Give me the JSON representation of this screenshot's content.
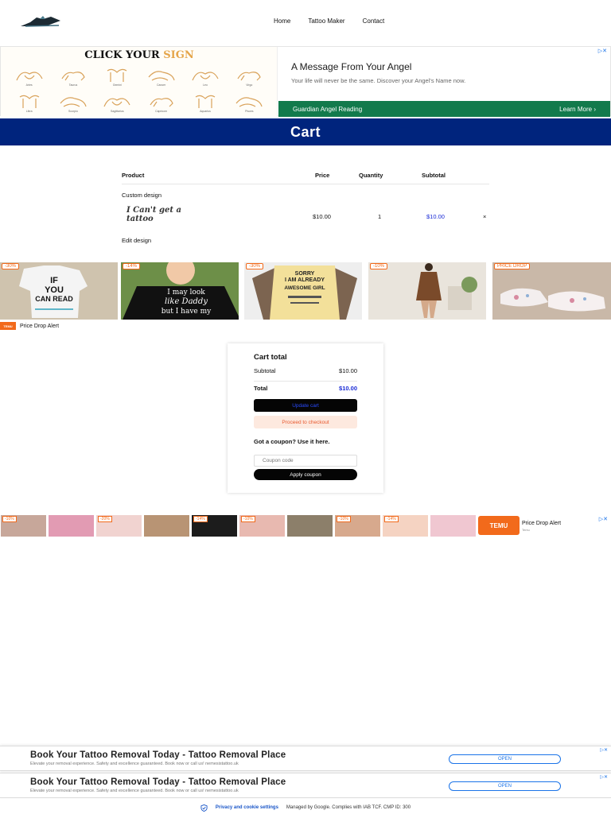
{
  "header": {
    "nav": [
      "Home",
      "Tattoo Maker",
      "Contact"
    ]
  },
  "ad_top": {
    "zodiac_title_a": "CLICK YOUR ",
    "zodiac_title_b": "SIGN",
    "signs": [
      "Aries",
      "Taurus",
      "Gemini",
      "Cancer",
      "Leo",
      "Virgo",
      "Libra",
      "Scorpio",
      "Sagittarius",
      "Capricorn",
      "Aquarius",
      "Pisces"
    ],
    "headline": "A Message From Your Angel",
    "subtext": "Your life will never be the same. Discover your Angel's Name now.",
    "brand": "Guardian Angel Reading",
    "cta": "Learn More",
    "cta_icon": "chevron-right-icon"
  },
  "page_title": "Cart",
  "cart": {
    "columns": [
      "Product",
      "Price",
      "Quantity",
      "Subtotal"
    ],
    "group_label": "Custom design",
    "item": {
      "thumb_text": "I Can't get a tattoo",
      "price": "$10.00",
      "quantity": "1",
      "subtotal": "$10.00",
      "remove": "×"
    },
    "edit_label": "Edit design"
  },
  "ad_products": {
    "badges": [
      "-30%",
      "-14%",
      "-30%",
      "-10%",
      "PRICE DROP"
    ],
    "tee_text_1": "IF YOU CAN READ",
    "tee_text_2": "I may look like my Daddy but I have my Mommy's",
    "tee_text_3": "SORRY I AM ALREADY AWESOME GIRL",
    "brand_small": "TEMU",
    "label": "Price Drop Alert",
    "sublabel": "Temu"
  },
  "cart_total": {
    "title": "Cart total",
    "subtotal_label": "Subtotal",
    "subtotal_value": "$10.00",
    "total_label": "Total",
    "total_value": "$10.00",
    "update_button": "Update cart",
    "checkout_button": "Proceed to checkout",
    "coupon_title": "Got a coupon? Use it here.",
    "coupon_placeholder": "Coupon code",
    "apply_button": "Apply coupon"
  },
  "ad_strip": {
    "badges": [
      "-10%",
      "",
      "-20%",
      "",
      "-14%",
      "-10%",
      "",
      "-10%",
      "-14%",
      ""
    ],
    "brand": "TEMU",
    "label": "Price Drop Alert",
    "sublabel": "Temu"
  },
  "bottom_ads": [
    {
      "headline": "Book Your Tattoo Removal Today - Tattoo Removal Place",
      "subtext": "Elevate your removal experience. Safety and excellence guaranteed. Book now or call us! nemesistattoo.uk",
      "cta": "OPEN"
    },
    {
      "headline": "Book Your Tattoo Removal Today - Tattoo Removal Place",
      "subtext": "Elevate your removal experience. Safety and excellence guaranteed. Book now or call us! nemesistattoo.uk",
      "cta": "OPEN"
    }
  ],
  "footer": {
    "privacy": "Privacy and cookie settings",
    "managed": "Managed by Google. Complies with IAB TCF. CMP ID: 300"
  },
  "colors": {
    "title_bar": "#00247d",
    "ad_green": "#127a4c",
    "temu_orange": "#f26a1b",
    "link_blue": "#1a2bd6"
  }
}
